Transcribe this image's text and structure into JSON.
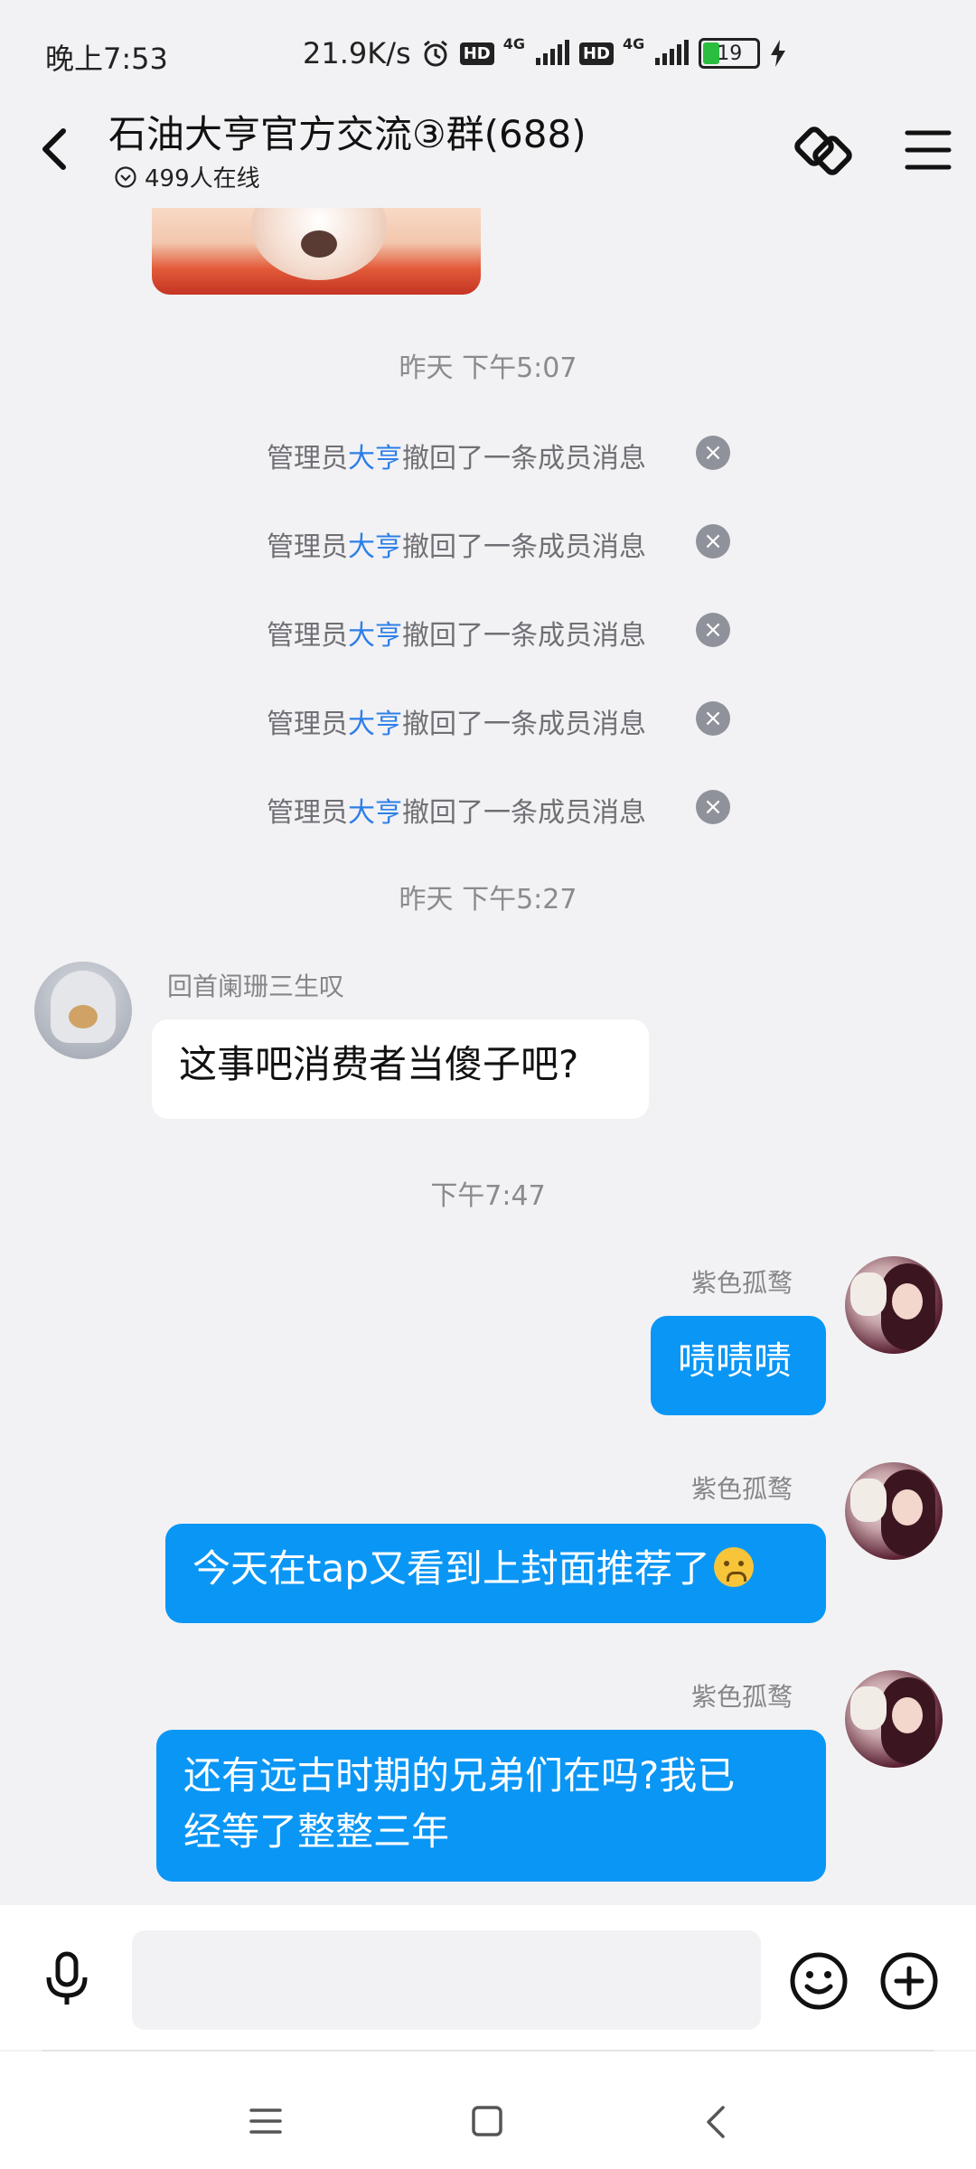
{
  "status_bar": {
    "time": "晚上7:53",
    "network_speed": "21.9K/s",
    "hd_label": "HD",
    "network_type": "4G",
    "battery_level": "19",
    "icons": [
      "alarm-icon",
      "hd-icon",
      "signal-4g-icon",
      "hd-icon",
      "signal-4g-icon",
      "battery-icon",
      "charging-icon"
    ]
  },
  "header": {
    "title": "石油大亨官方交流③群(688)",
    "online_count": "499人在线",
    "icons": [
      "back-arrow-icon",
      "online-dropdown-icon",
      "link-icon",
      "menu-icon"
    ]
  },
  "messages": {
    "time_1": "昨天  下午5:07",
    "recalls": [
      {
        "prefix": "管理员",
        "admin": "大亨",
        "suffix": "撤回了一条成员消息"
      },
      {
        "prefix": "管理员",
        "admin": "大亨",
        "suffix": "撤回了一条成员消息"
      },
      {
        "prefix": "管理员",
        "admin": "大亨",
        "suffix": "撤回了一条成员消息"
      },
      {
        "prefix": "管理员",
        "admin": "大亨",
        "suffix": "撤回了一条成员消息"
      },
      {
        "prefix": "管理员",
        "admin": "大亨",
        "suffix": "撤回了一条成员消息"
      }
    ],
    "time_2": "昨天  下午5:27",
    "left_msg": {
      "sender": "回首阑珊三生叹",
      "text": "这事吧消费者当傻子吧?"
    },
    "time_3": "下午7:47",
    "right_msgs": [
      {
        "sender": "紫色孤鹜",
        "text": "啧啧啧"
      },
      {
        "sender": "紫色孤鹜",
        "text": "今天在tap又看到上封面推荐了"
      },
      {
        "sender": "紫色孤鹜",
        "line1": "还有远古时期的兄弟们在吗?我已",
        "line2": "经等了整整三年"
      }
    ]
  },
  "input_bar": {
    "placeholder": "",
    "icons": [
      "microphone-icon",
      "emoji-icon",
      "plus-icon"
    ]
  },
  "nav_bar": {
    "icons": [
      "menu-nav-icon",
      "home-nav-icon",
      "back-nav-icon"
    ]
  },
  "colors": {
    "background": "#f2f2f4",
    "bubble_self": "#0a96f5",
    "bubble_other": "#ffffff",
    "admin_link": "#2d7fe8"
  }
}
